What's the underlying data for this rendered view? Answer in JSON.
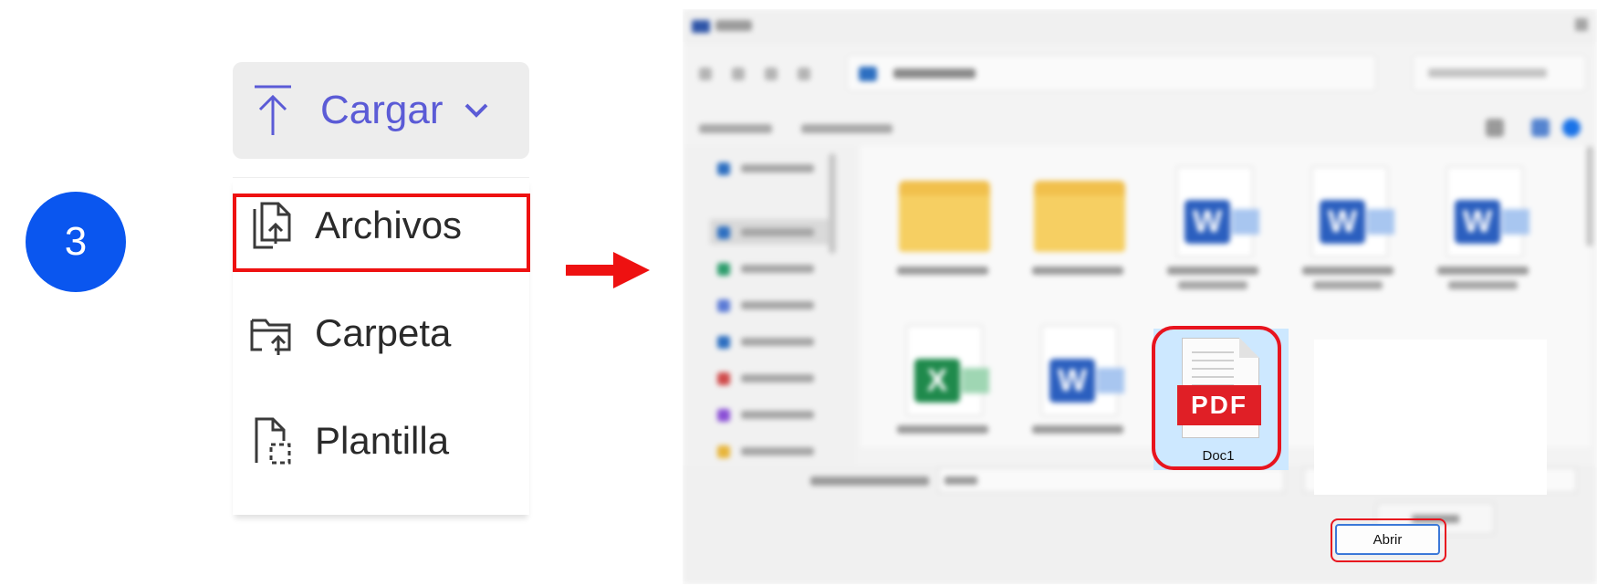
{
  "step_badge": {
    "number": "3",
    "color": "#0a56ef"
  },
  "upload_menu": {
    "button_label": "Cargar",
    "button_icon": "upload-icon",
    "dropdown_icon": "chevron-down-icon",
    "items": [
      {
        "label": "Archivos",
        "icon": "file-upload-icon",
        "highlighted": true
      },
      {
        "label": "Carpeta",
        "icon": "folder-upload-icon",
        "highlighted": false
      },
      {
        "label": "Plantilla",
        "icon": "template-icon",
        "highlighted": false
      }
    ]
  },
  "arrow": {
    "color": "#ee1111"
  },
  "open_dialog": {
    "blurred": true,
    "selected_file": {
      "name": "Doc1",
      "badge": "PDF",
      "badge_color": "#e01f26"
    },
    "open_button_label": "Abrir",
    "highlight_color": "#e8141e"
  }
}
